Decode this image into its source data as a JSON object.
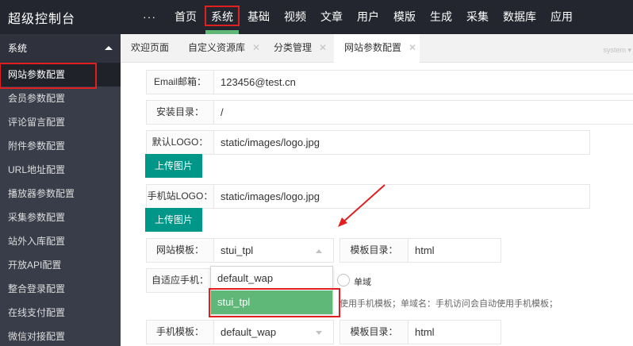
{
  "app": {
    "title": "超级控制台"
  },
  "nav": {
    "more": "···",
    "items": [
      "首页",
      "系统",
      "基础",
      "视频",
      "文章",
      "用户",
      "模版",
      "生成",
      "采集",
      "数据库",
      "应用"
    ],
    "active": "系统"
  },
  "sidebar": {
    "section": "系统",
    "items": [
      "网站参数配置",
      "会员参数配置",
      "评论留言配置",
      "附件参数配置",
      "URL地址配置",
      "播放器参数配置",
      "采集参数配置",
      "站外入库配置",
      "开放API配置",
      "整合登录配置",
      "在线支付配置",
      "微信对接配置"
    ],
    "active": "网站参数配置"
  },
  "tabs": [
    {
      "label": "欢迎页面",
      "closable": false
    },
    {
      "label": "自定义资源库",
      "closable": true
    },
    {
      "label": "分类管理",
      "closable": true
    },
    {
      "label": "网站参数配置",
      "closable": true,
      "active": true
    }
  ],
  "tabs_extra": "system ▾",
  "form": {
    "email": {
      "label": "Email邮箱：",
      "value": "123456@test.cn"
    },
    "install_dir": {
      "label": "安装目录：",
      "value": "/"
    },
    "logo": {
      "label": "默认LOGO：",
      "value": "static/images/logo.jpg",
      "button": "上传图片"
    },
    "mobile_logo": {
      "label": "手机站LOGO：",
      "value": "static/images/logo.jpg",
      "button": "上传图片"
    },
    "site_template": {
      "label": "网站模板：",
      "value": "stui_tpl",
      "dir_label": "模板目录：",
      "dir_value": "html"
    },
    "template_options": [
      "default_wap",
      "stui_tpl"
    ],
    "template_selected": "stui_tpl",
    "mobile_adapt": {
      "label": "自适应手机：",
      "radio_label": "单域",
      "hint": "使用手机模板；单域名：手机访问会自动使用手机模板；"
    },
    "mobile_template": {
      "label": "手机模板：",
      "value": "default_wap",
      "dir_label": "模板目录：",
      "dir_value": "html"
    }
  },
  "colors": {
    "topbar": "#23262e",
    "sidebar": "#393d49",
    "accent": "#5fb878",
    "button": "#009688",
    "highlight": "#e02020"
  }
}
